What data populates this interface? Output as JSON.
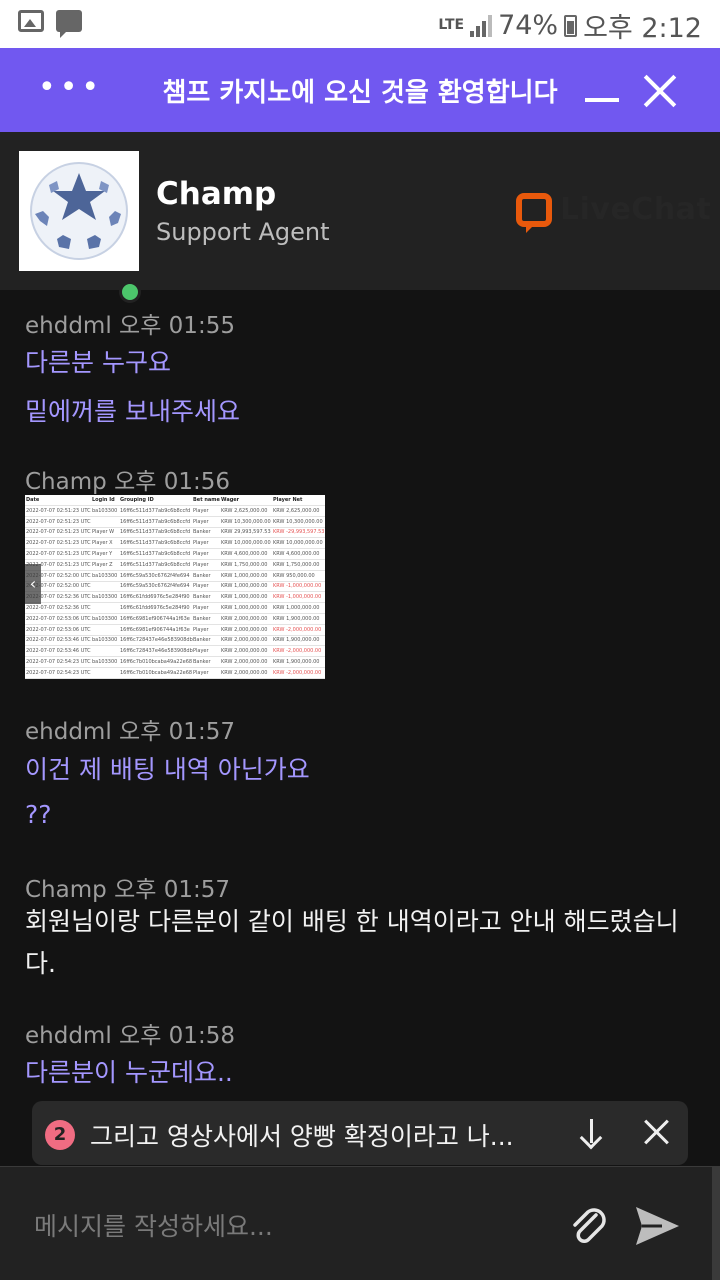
{
  "status_bar": {
    "network": "LTE",
    "battery": "74%",
    "time": "오후 2:12"
  },
  "header": {
    "title": "챔프 카지노에 오신 것을 환영합니다",
    "menu_icon": "more-dots-icon",
    "minimize_icon": "minimize-icon",
    "close_icon": "close-icon",
    "accent_color": "#7158f0"
  },
  "agent": {
    "name": "Champ",
    "role": "Support Agent",
    "status": "online",
    "brand": "LiveChat",
    "brand_color": "#e8590c"
  },
  "messages": [
    {
      "author": "ehddml",
      "time": "오후 01:55",
      "lines": [
        "다른분 누구요",
        "밑에꺼를 보내주세요"
      ]
    },
    {
      "author": "Champ",
      "time": "오후 01:56",
      "attachment": {
        "headers": [
          "Date",
          "Login Id",
          "Grouping ID",
          "Bet name",
          "Wager",
          "Player Net"
        ],
        "rows": [
          [
            "2022-07-07 02:51:23 UTC",
            "ba103300",
            "16ff6c511d377ab9c6b8ccfd",
            "Player",
            "KRW 2,625,000.00",
            "KRW 2,625,000.00"
          ],
          [
            "2022-07-07 02:51:23 UTC",
            "",
            "16ff6c511d377ab9c6b8ccfd",
            "Player",
            "KRW 10,300,000.00",
            "KRW 10,300,000.00"
          ],
          [
            "2022-07-07 02:51:23 UTC",
            "Player W",
            "16ff6c511d377ab9c6b8ccfd",
            "Banker",
            "KRW 29,993,597.53",
            "KRW -29,993,597.53"
          ],
          [
            "2022-07-07 02:51:23 UTC",
            "Player X",
            "16ff6c511d377ab9c6b8ccfd",
            "Player",
            "KRW 10,000,000.00",
            "KRW 10,000,000.00"
          ],
          [
            "2022-07-07 02:51:23 UTC",
            "Player Y",
            "16ff6c511d377ab9c6b8ccfd",
            "Player",
            "KRW 4,600,000.00",
            "KRW 4,600,000.00"
          ],
          [
            "2022-07-07 02:51:23 UTC",
            "Player Z",
            "16ff6c511d377ab9c6b8ccfd",
            "Player",
            "KRW 1,750,000.00",
            "KRW 1,750,000.00"
          ],
          [
            "2022-07-07 02:52:00 UTC",
            "ba103300",
            "16ff6c59a530c6762f4fe694",
            "Banker",
            "KRW 1,000,000.00",
            "KRW 950,000.00"
          ],
          [
            "2022-07-07 02:52:00 UTC",
            "",
            "16ff6c59a530c6762f4fe694",
            "Player",
            "KRW 1,000,000.00",
            "KRW -1,000,000.00"
          ],
          [
            "2022-07-07 02:52:36 UTC",
            "ba103300",
            "16ff6c61fdd6976c5e284f90",
            "Banker",
            "KRW 1,000,000.00",
            "KRW -1,000,000.00"
          ],
          [
            "2022-07-07 02:52:36 UTC",
            "",
            "16ff6c61fdd6976c5e284f90",
            "Player",
            "KRW 1,000,000.00",
            "KRW 1,000,000.00"
          ],
          [
            "2022-07-07 02:53:06 UTC",
            "ba103300",
            "16ff6c6981ef906744a1f63e",
            "Banker",
            "KRW 2,000,000.00",
            "KRW 1,900,000.00"
          ],
          [
            "2022-07-07 02:53:06 UTC",
            "",
            "16ff6c6981ef906744a1f63e",
            "Player",
            "KRW 2,000,000.00",
            "KRW -2,000,000.00"
          ],
          [
            "2022-07-07 02:53:46 UTC",
            "ba103300",
            "16ff6c728437e46e583908db",
            "Banker",
            "KRW 2,000,000.00",
            "KRW 1,900,000.00"
          ],
          [
            "2022-07-07 02:53:46 UTC",
            "",
            "16ff6c728437e46e583908db",
            "Player",
            "KRW 2,000,000.00",
            "KRW -2,000,000.00"
          ],
          [
            "2022-07-07 02:54:23 UTC",
            "ba103300",
            "16ff6c7b010bcaba49a22e68",
            "Banker",
            "KRW 2,000,000.00",
            "KRW 1,900,000.00"
          ],
          [
            "2022-07-07 02:54:23 UTC",
            "",
            "16ff6c7b010bcaba49a22e68",
            "Player",
            "KRW 2,000,000.00",
            "KRW -2,000,000.00"
          ]
        ]
      }
    },
    {
      "author": "ehddml",
      "time": "오후 01:57",
      "lines": [
        "이건 제 배팅 내역 아닌가요",
        "??"
      ]
    },
    {
      "author": "Champ",
      "time": "오후 01:57",
      "lines": [
        "회원님이랑 다른분이 같이 배팅 한 내역이라고 안내 해드렸습니다."
      ]
    },
    {
      "author": "ehddml",
      "time": "오후 01:58",
      "lines": [
        "다른분이 누군데요.."
      ]
    }
  ],
  "toast": {
    "count": "2",
    "text": "그리고 영상사에서 양빵 확정이라고 나..."
  },
  "composer": {
    "placeholder": "메시지를 작성하세요..."
  }
}
